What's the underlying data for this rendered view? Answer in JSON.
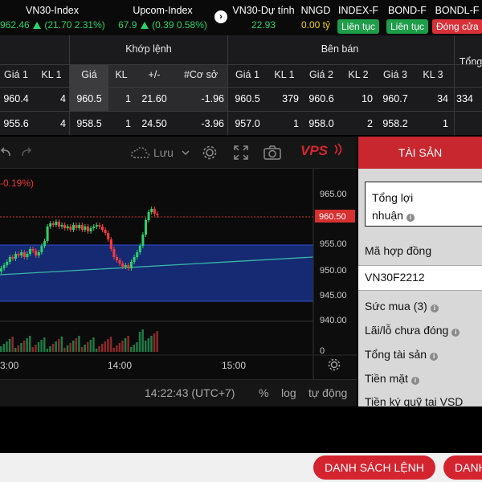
{
  "ticker": [
    {
      "name": "VN30-Index",
      "value": "962.46",
      "change": "(21.70 2.31%)"
    },
    {
      "name": "Upcom-Index",
      "value": "67.9",
      "change": "(0.39 0.58%)"
    },
    {
      "name": "VN30-Dự tính",
      "value": "22.93"
    },
    {
      "name": "NNGD",
      "value": "0.00 tỷ"
    },
    {
      "name": "INDEX-F",
      "badge": "Liên tục"
    },
    {
      "name": "BOND-F",
      "badge": "Liên tục"
    },
    {
      "name": "BONDL-F",
      "badge": "Đóng cửa"
    }
  ],
  "table": {
    "group_match": "Khớp lệnh",
    "group_sell": "Bên bán",
    "group_total": "Tổng",
    "headers": [
      "Giá 1",
      "KL 1",
      "Giá",
      "KL",
      "+/-",
      "#Cơ sở",
      "Giá 1",
      "KL 1",
      "Giá 2",
      "KL 2",
      "Giá 3",
      "KL 3"
    ],
    "rows": [
      [
        "960.4",
        "4",
        "960.5",
        "1",
        "21.60",
        "-1.96",
        "960.5",
        "379",
        "960.6",
        "10",
        "960.7",
        "34",
        "334"
      ],
      [
        "955.6",
        "4",
        "958.5",
        "1",
        "24.50",
        "-3.96",
        "957.0",
        "1",
        "958.0",
        "2",
        "958.2",
        "1",
        ""
      ]
    ]
  },
  "chart": {
    "toolbar_save": "Lưu",
    "logo": "VPS",
    "change_label": "-0.19%)",
    "current_price": "960.50",
    "price_ticks": [
      "965.00",
      "955.00",
      "950.00",
      "945.00",
      "940.00"
    ],
    "volume_tick": "0",
    "time_ticks": [
      "3:00",
      "14:00",
      "15:00"
    ],
    "clock": "14:22:43 (UTC+7)",
    "opt_percent": "%",
    "opt_log": "log",
    "opt_auto": "tự động"
  },
  "panel": {
    "title": "TÀI SẢN",
    "card_line1": "Tổng lợi",
    "card_line2": "nhuận",
    "contract_label": "Mã hợp đồng",
    "contract_value": "VN30F2212",
    "items": [
      "Sức mua (3)",
      "Lãi/lỗ chưa đóng",
      "Tổng tài sản",
      "Tiền mặt",
      "Tiền ký quỹ tại VSD"
    ]
  },
  "footer": {
    "btn1": "DANH SÁCH LỆNH",
    "btn2": "DANH"
  },
  "colors": {
    "up": "#2bd16a",
    "down": "#ff3b3b",
    "ref": "#f1d400",
    "accent": "#c8272f"
  }
}
